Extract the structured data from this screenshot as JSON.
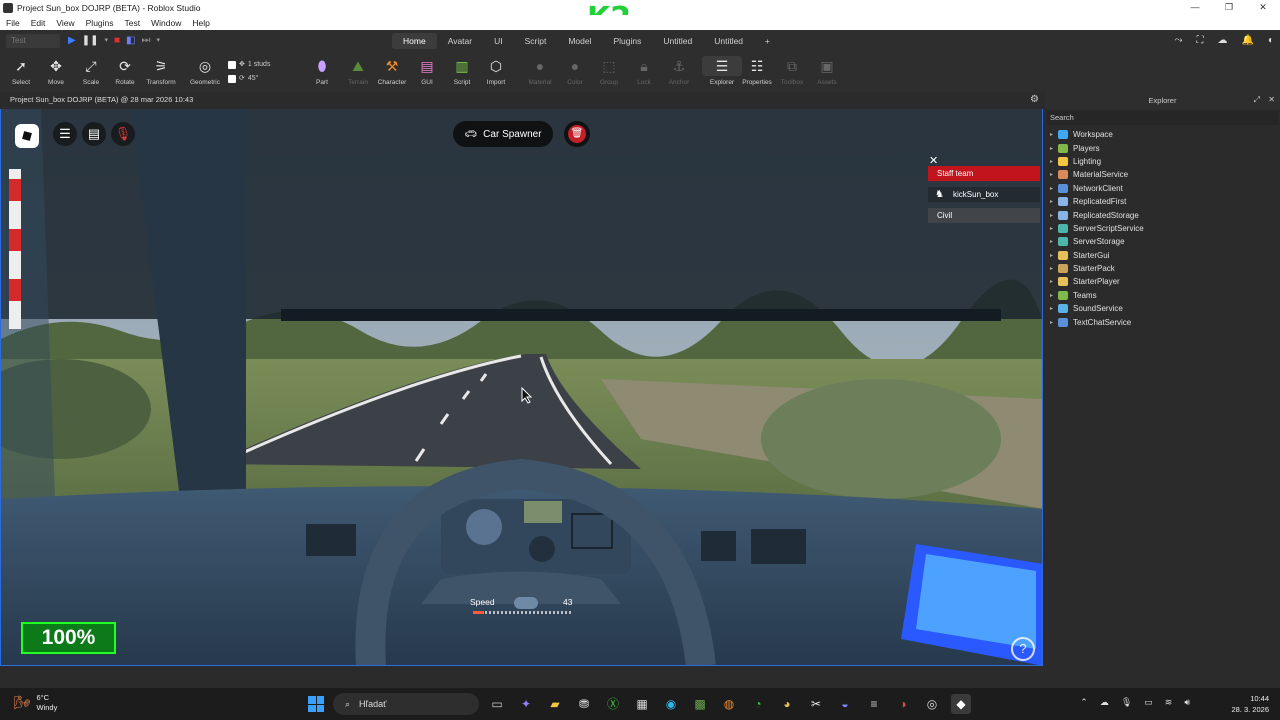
{
  "window": {
    "title": "Project Sun_box DOJRP (BETA) - Roblox Studio",
    "controls": [
      "—",
      "❐",
      "✕"
    ]
  },
  "logo_text": "K2",
  "menu": [
    "File",
    "Edit",
    "View",
    "Plugins",
    "Test",
    "Window",
    "Help"
  ],
  "toolbar": {
    "test_select": "Test",
    "tabs": [
      "Home",
      "Avatar",
      "UI",
      "Script",
      "Model",
      "Plugins",
      "Untitled",
      "Untitled",
      "+"
    ],
    "active_tab": "Home"
  },
  "ribbon": {
    "select": "Select",
    "move": "Move",
    "scale": "Scale",
    "rotate": "Rotate",
    "transform": "Transform",
    "geometric": "Geometric",
    "studs": "1 studs",
    "degrees": "45°",
    "part": "Part",
    "terrain": "Terrain",
    "character": "Character",
    "gui": "GUI",
    "script": "Script",
    "import": "Import",
    "material": "Material",
    "color": "Color",
    "group": "Group",
    "lock": "Lock",
    "anchor": "Anchor",
    "explorer": "Explorer",
    "properties": "Properties",
    "toolbox": "Toolbox",
    "assets": "Assets"
  },
  "doc_tab": "Project Sun_box DOJRP (BETA) @ 28 mar 2026 10:43",
  "game": {
    "car_spawner": "Car Spawner",
    "teams": {
      "staff": "Staff team",
      "player": "kickSun_box",
      "civil": "Civil"
    },
    "speed_label": "Speed",
    "speed_value": "43",
    "zoom": "100%",
    "help": "?"
  },
  "explorer": {
    "title": "Explorer",
    "search_placeholder": "Search",
    "items": [
      {
        "label": "Workspace",
        "icon": "globe-icon",
        "color": "#3fa9f5"
      },
      {
        "label": "Players",
        "icon": "players-icon",
        "color": "#7fb94a"
      },
      {
        "label": "Lighting",
        "icon": "bulb-icon",
        "color": "#f5c542"
      },
      {
        "label": "MaterialService",
        "icon": "material-icon",
        "color": "#d98b5a"
      },
      {
        "label": "NetworkClient",
        "icon": "network-icon",
        "color": "#5a8fd9"
      },
      {
        "label": "ReplicatedFirst",
        "icon": "folder-icon",
        "color": "#8ab4e8"
      },
      {
        "label": "ReplicatedStorage",
        "icon": "folder-icon",
        "color": "#8ab4e8"
      },
      {
        "label": "ServerScriptService",
        "icon": "script-service-icon",
        "color": "#4db6ac"
      },
      {
        "label": "ServerStorage",
        "icon": "storage-icon",
        "color": "#4db6ac"
      },
      {
        "label": "StarterGui",
        "icon": "gui-icon",
        "color": "#e8c05a"
      },
      {
        "label": "StarterPack",
        "icon": "pack-icon",
        "color": "#c9a35a"
      },
      {
        "label": "StarterPlayer",
        "icon": "player-icon",
        "color": "#e8c05a"
      },
      {
        "label": "Teams",
        "icon": "teams-icon",
        "color": "#7fb94a"
      },
      {
        "label": "SoundService",
        "icon": "sound-icon",
        "color": "#5ab0e8"
      },
      {
        "label": "TextChatService",
        "icon": "chat-icon",
        "color": "#5a8fd9"
      }
    ]
  },
  "taskbar": {
    "temp": "6°C",
    "weather": "Windy",
    "search": "Hľadať",
    "time": "10:44",
    "date": "28. 3. 2026"
  }
}
